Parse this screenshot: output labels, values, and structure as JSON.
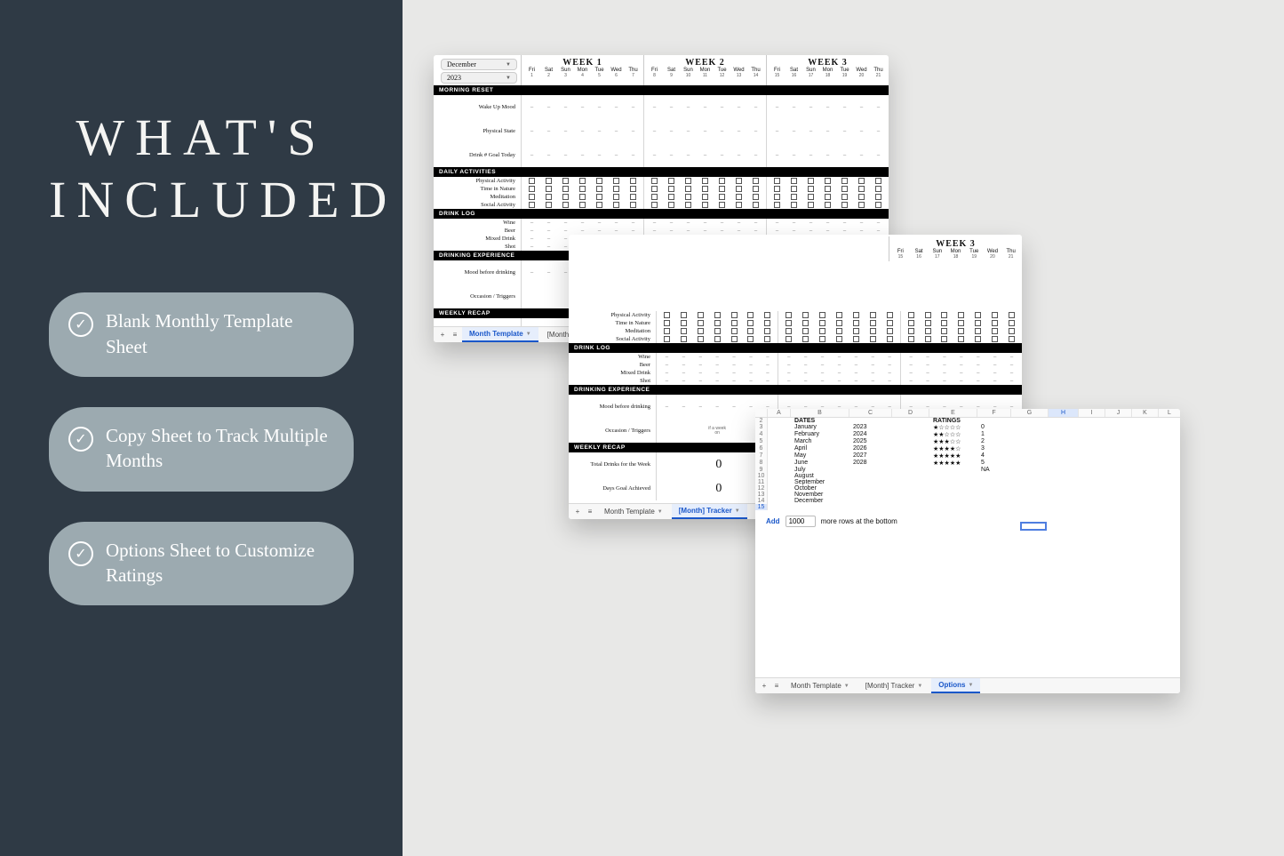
{
  "left": {
    "headline_l1": "WHAT'S",
    "headline_l2": "INCLUDED",
    "bullets": [
      "Blank Monthly Template Sheet",
      "Copy Sheet to Track Multiple Months",
      "Options Sheet to Customize Ratings"
    ]
  },
  "weeks": {
    "titles": [
      "WEEK 1",
      "WEEK 2",
      "WEEK 3"
    ],
    "days": [
      "Fri",
      "Sat",
      "Sun",
      "Mon",
      "Tue",
      "Wed",
      "Thu"
    ],
    "nums_w1": [
      "1",
      "2",
      "3",
      "4",
      "5",
      "6",
      "7"
    ],
    "nums_w2": [
      "8",
      "9",
      "10",
      "11",
      "12",
      "13",
      "14"
    ],
    "nums_w3": [
      "15",
      "16",
      "17",
      "18",
      "19",
      "20",
      "21"
    ]
  },
  "picker": {
    "month": "December",
    "year": "2023"
  },
  "sections": {
    "morning": {
      "title": "MORNING RESET",
      "rows": [
        "Wake Up Mood",
        "Physical State",
        "Drink # Goal Today"
      ]
    },
    "daily": {
      "title": "DAILY ACTIVITIES",
      "rows": [
        "Physical Activity",
        "Time in Nature",
        "Meditation",
        "Social Activity"
      ]
    },
    "drinklog": {
      "title": "DRINK LOG",
      "rows": [
        "Wine",
        "Beer",
        "Mixed Drink",
        "Shot"
      ]
    },
    "exp": {
      "title": "DRINKING EXPERIENCE",
      "rows": [
        "Mood before drinking",
        "Occasion / Triggers"
      ]
    },
    "recap": {
      "title": "WEEKLY RECAP",
      "rows": [
        "Total Drinks for the Week",
        "Days Goal Achieved"
      ]
    }
  },
  "occasion_note_l1": "if a week",
  "occasion_note_l2": "on",
  "occasion_note_l3": "",
  "tabsA": {
    "t1": "Month Template",
    "t2": "[Month] Tracker",
    "t3": "Options"
  },
  "tabsB": {
    "t1": "Month Template",
    "t2": "[Month] Tracker",
    "t3": "Options"
  },
  "tabsC": {
    "t1": "Month Template",
    "t2": "[Month] Tracker",
    "t3": "Options"
  },
  "cardB_extra_daily_rows": [
    "Physical Activity",
    "Time in Nature",
    "Meditation",
    "Social Activity"
  ],
  "options_sheet": {
    "col_letters": [
      "A",
      "B",
      "C",
      "D",
      "E",
      "F",
      "G",
      "H",
      "I",
      "J",
      "K",
      "L"
    ],
    "hdr_dates": "DATES",
    "hdr_ratings": "RATINGS",
    "rows": [
      {
        "n": "2",
        "month": "",
        "year": "",
        "stars": "",
        "val": ""
      },
      {
        "n": "3",
        "month": "January",
        "year": "2023",
        "stars": "★☆☆☆☆",
        "val": "0"
      },
      {
        "n": "4",
        "month": "February",
        "year": "2024",
        "stars": "★★☆☆☆",
        "val": "1"
      },
      {
        "n": "5",
        "month": "March",
        "year": "2025",
        "stars": "★★★☆☆",
        "val": "2"
      },
      {
        "n": "6",
        "month": "April",
        "year": "2026",
        "stars": "★★★★☆",
        "val": "3"
      },
      {
        "n": "7",
        "month": "May",
        "year": "2027",
        "stars": "★★★★★",
        "val": "4"
      },
      {
        "n": "8",
        "month": "June",
        "year": "2028",
        "stars": "★★★★★",
        "val": "5"
      },
      {
        "n": "9",
        "month": "July",
        "year": "",
        "stars": "",
        "val": "NA"
      },
      {
        "n": "10",
        "month": "August",
        "year": "",
        "stars": "",
        "val": ""
      },
      {
        "n": "11",
        "month": "September",
        "year": "",
        "stars": "",
        "val": ""
      },
      {
        "n": "12",
        "month": "October",
        "year": "",
        "stars": "",
        "val": ""
      },
      {
        "n": "13",
        "month": "November",
        "year": "",
        "stars": "",
        "val": ""
      },
      {
        "n": "14",
        "month": "December",
        "year": "",
        "stars": "",
        "val": ""
      }
    ],
    "hl_row_n": "15",
    "add_label": "Add",
    "add_count": "1000",
    "add_suffix": "more rows at the bottom"
  }
}
